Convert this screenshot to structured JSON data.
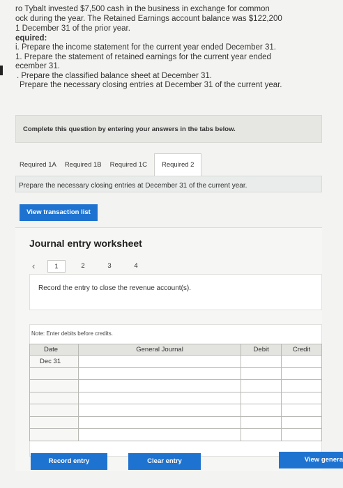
{
  "intro": {
    "line1": "ro Tybalt invested $7,500 cash in the business in exchange for common",
    "line2": "ock during the year. The Retained Earnings account balance was $122,200",
    "line3": "1 December 31 of the prior year."
  },
  "required": {
    "title": "equired:",
    "items": [
      "i. Prepare the income statement for the current year ended December 31.",
      "1. Prepare the statement of retained earnings for the current year ended",
      "ecember 31.",
      ". Prepare the classified balance sheet at December 31.",
      "Prepare the necessary closing entries at December 31 of the current year."
    ]
  },
  "banner": "Complete this question by entering your answers in the tabs below.",
  "tabs": [
    "Required 1A",
    "Required 1B",
    "Required 1C",
    "Required 2"
  ],
  "instruction": "Prepare the necessary closing entries at December 31 of the current year.",
  "view_transaction_list": "View transaction list",
  "worksheet": {
    "title": "Journal entry worksheet",
    "pages": [
      "1",
      "2",
      "3",
      "4"
    ],
    "entry_text": "Record the entry to close the revenue account(s).",
    "note": "Note: Enter debits before credits.",
    "columns": {
      "date": "Date",
      "general_journal": "General Journal",
      "debit": "Debit",
      "credit": "Credit"
    },
    "first_date": "Dec 31"
  },
  "buttons": {
    "record": "Record entry",
    "clear": "Clear entry",
    "view_general": "View genera"
  }
}
